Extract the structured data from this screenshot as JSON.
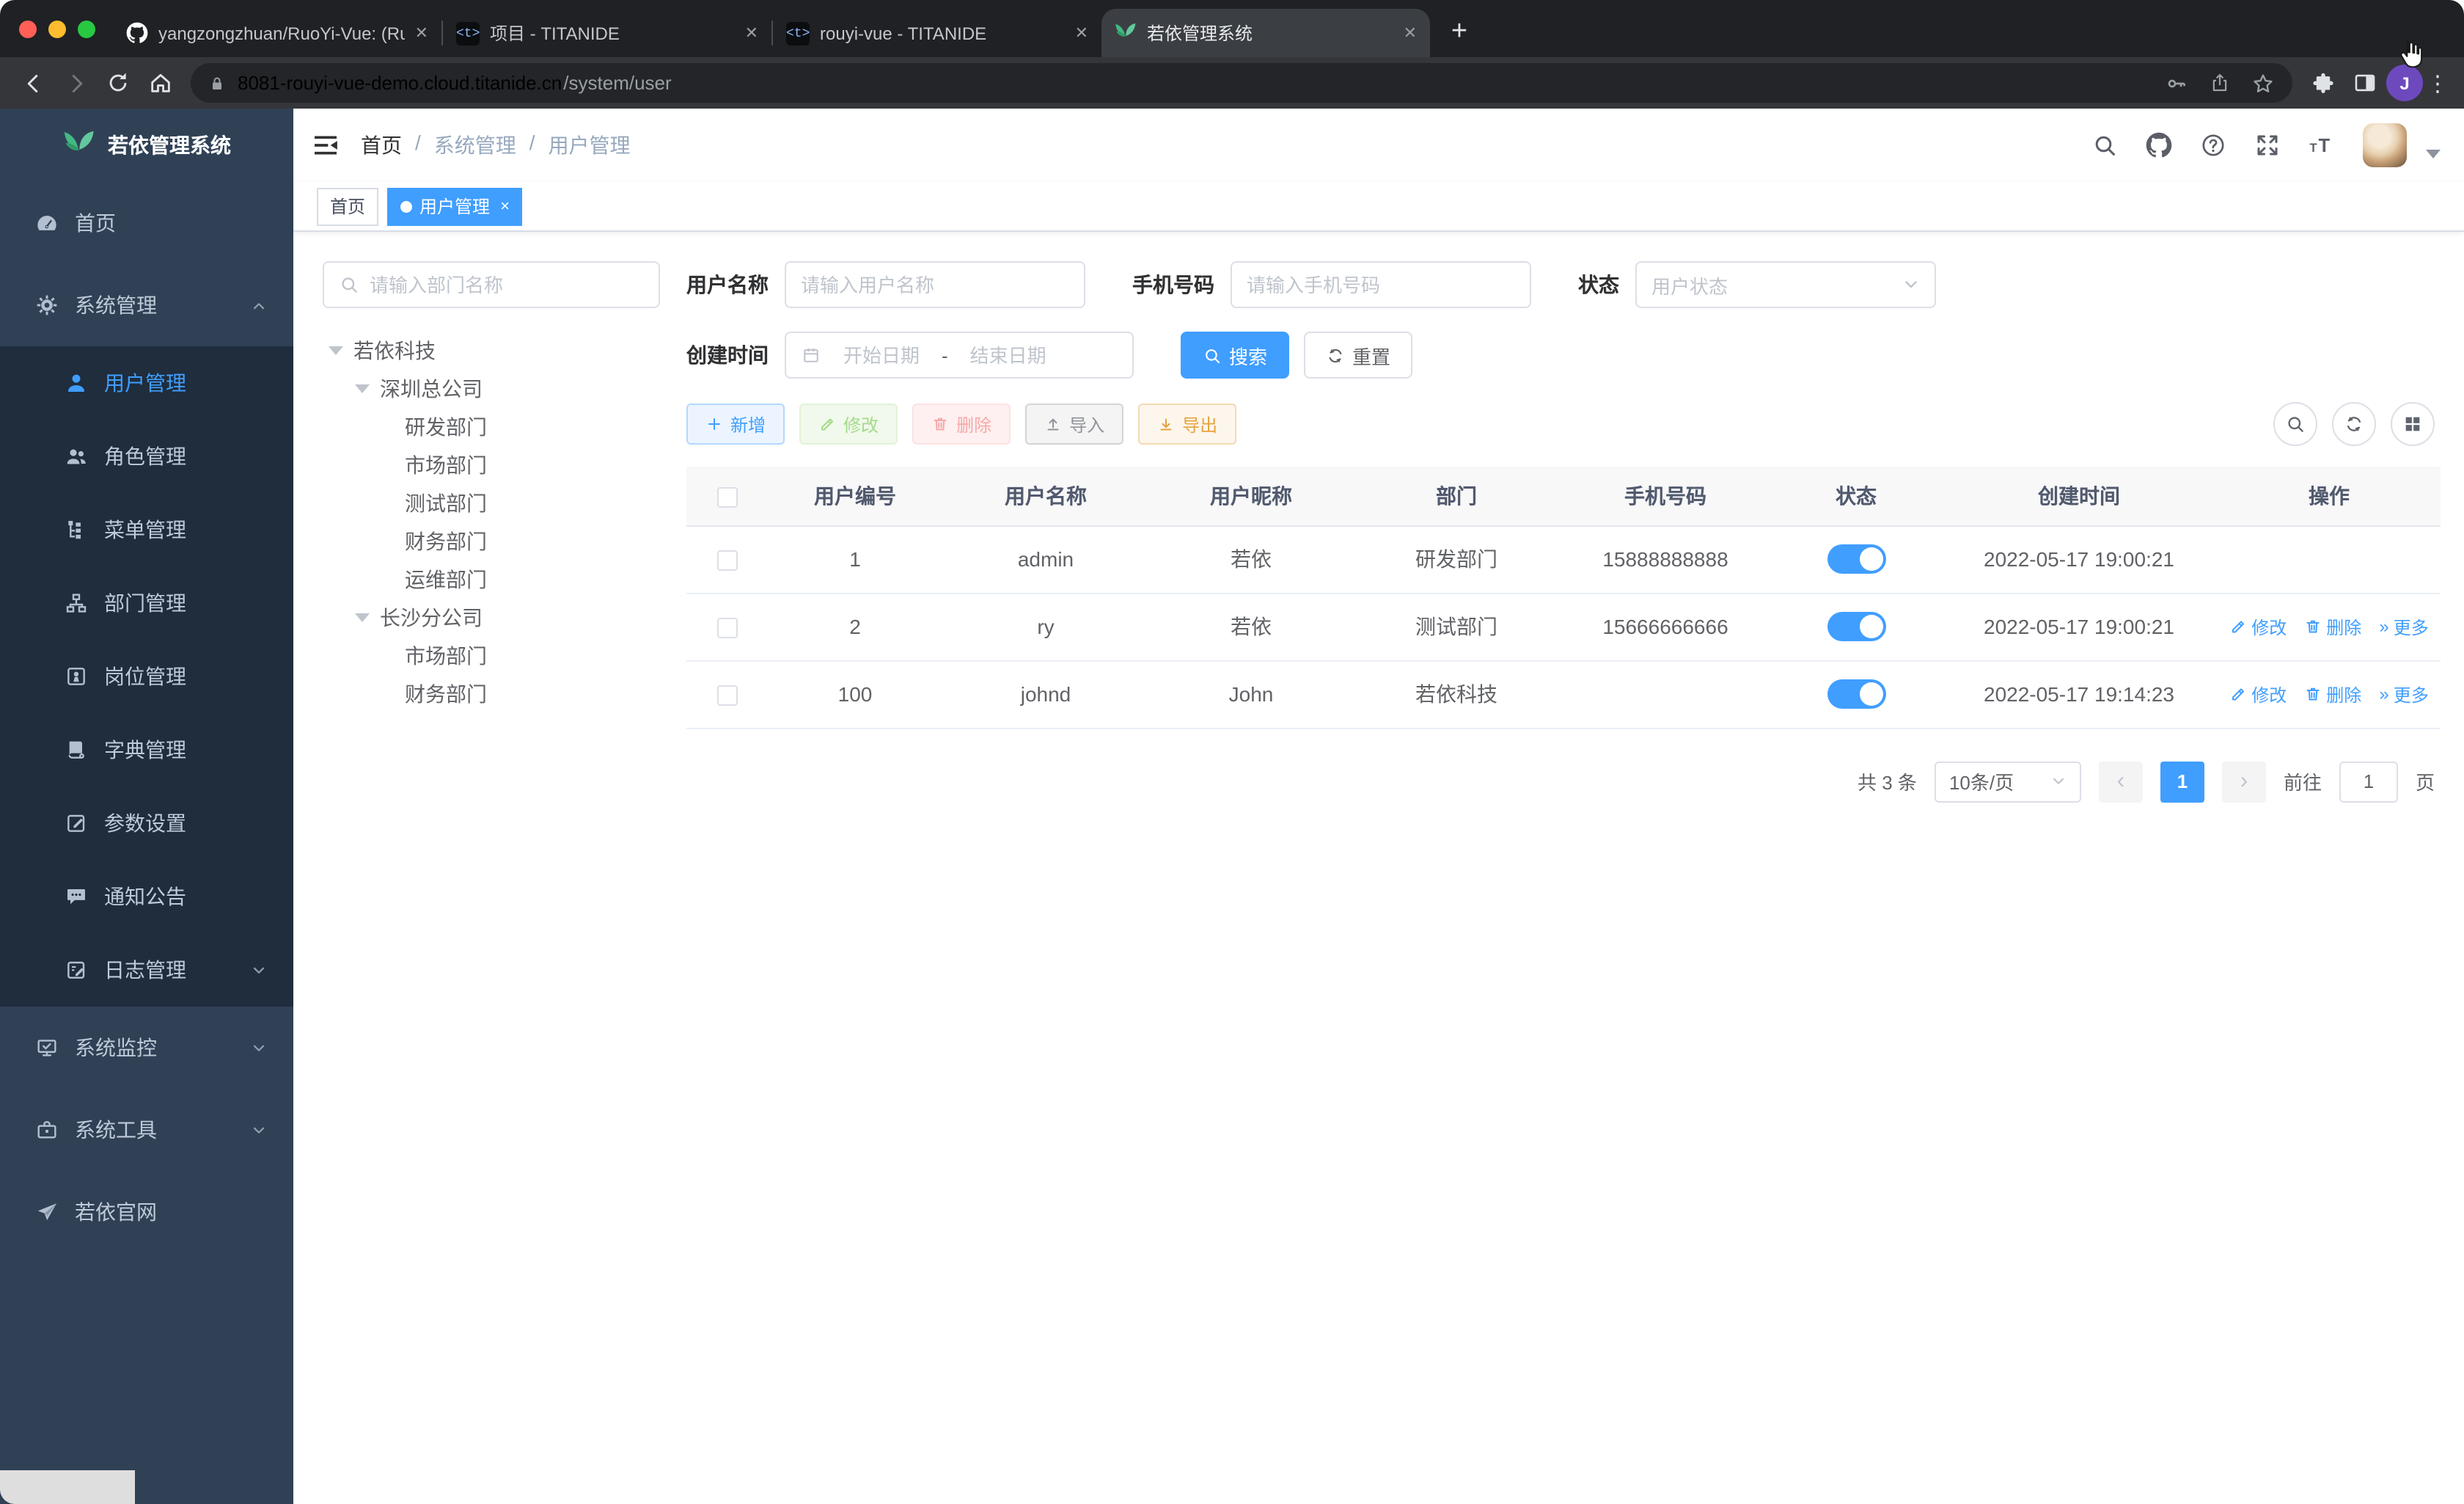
{
  "browser": {
    "tabs": [
      {
        "title": "yangzongzhuan/RuoYi-Vue: (Ru",
        "icon": "github"
      },
      {
        "title": "项目 - TITANIDE",
        "icon": "titanide"
      },
      {
        "title": "rouyi-vue - TITANIDE",
        "icon": "titanide"
      },
      {
        "title": "若依管理系统",
        "icon": "ruoyi-leaf"
      }
    ],
    "code_icon_glyph": "<t>",
    "close_glyph": "✕",
    "new_tab_glyph": "+",
    "url": {
      "host": "8081-rouyi-vue-demo.cloud.titanide.cn",
      "path": "/system/user"
    },
    "profile_initial": "J",
    "menu_glyph": "⋮"
  },
  "sidebar": {
    "logo_title": "若依管理系统",
    "items": [
      {
        "label": "首页",
        "icon": "dashboard"
      },
      {
        "label": "系统管理",
        "icon": "gear",
        "chevron": "up"
      },
      {
        "label": "用户管理",
        "icon": "user",
        "active": true
      },
      {
        "label": "角色管理",
        "icon": "users"
      },
      {
        "label": "菜单管理",
        "icon": "menu-tree"
      },
      {
        "label": "部门管理",
        "icon": "org-tree"
      },
      {
        "label": "岗位管理",
        "icon": "badge"
      },
      {
        "label": "字典管理",
        "icon": "dictionary"
      },
      {
        "label": "参数设置",
        "icon": "edit-square"
      },
      {
        "label": "通知公告",
        "icon": "message"
      },
      {
        "label": "日志管理",
        "icon": "log",
        "chevron": "down"
      },
      {
        "label": "系统监控",
        "icon": "monitor",
        "chevron": "down"
      },
      {
        "label": "系统工具",
        "icon": "toolbox",
        "chevron": "down"
      },
      {
        "label": "若依官网",
        "icon": "paper-plane"
      }
    ]
  },
  "navbar": {
    "breadcrumb": [
      "首页",
      "系统管理",
      "用户管理"
    ],
    "separator": "/",
    "icons": [
      "search",
      "github",
      "help",
      "fullscreen",
      "font-size"
    ]
  },
  "tags": [
    {
      "label": "首页"
    },
    {
      "label": "用户管理",
      "active": true,
      "close_glyph": "×"
    }
  ],
  "dept_panel": {
    "search_placeholder": "请输入部门名称",
    "tree": [
      {
        "label": "若依科技",
        "children": [
          {
            "label": "深圳总公司",
            "children": [
              {
                "label": "研发部门"
              },
              {
                "label": "市场部门"
              },
              {
                "label": "测试部门"
              },
              {
                "label": "财务部门"
              },
              {
                "label": "运维部门"
              }
            ]
          },
          {
            "label": "长沙分公司",
            "children": [
              {
                "label": "市场部门"
              },
              {
                "label": "财务部门"
              }
            ]
          }
        ]
      }
    ]
  },
  "filter": {
    "username_label": "用户名称",
    "username_placeholder": "请输入用户名称",
    "phone_label": "手机号码",
    "phone_placeholder": "请输入手机号码",
    "status_label": "状态",
    "status_placeholder": "用户状态",
    "created_label": "创建时间",
    "date_start_placeholder": "开始日期",
    "date_separator": "-",
    "date_end_placeholder": "结束日期",
    "search_button": "搜索",
    "reset_button": "重置"
  },
  "toolbar": {
    "add": "新增",
    "edit": "修改",
    "delete": "删除",
    "import": "导入",
    "export": "导出"
  },
  "table": {
    "columns": [
      "用户编号",
      "用户名称",
      "用户昵称",
      "部门",
      "手机号码",
      "状态",
      "创建时间",
      "操作"
    ],
    "row_actions": {
      "edit": "修改",
      "delete": "删除",
      "more": "更多",
      "more_glyph": "»"
    },
    "rows": [
      {
        "user_id": "1",
        "username": "admin",
        "nickname": "若依",
        "dept": "研发部门",
        "phone": "15888888888",
        "status": "on",
        "created": "2022-05-17 19:00:21",
        "has_actions": false
      },
      {
        "user_id": "2",
        "username": "ry",
        "nickname": "若依",
        "dept": "测试部门",
        "phone": "15666666666",
        "status": "on",
        "created": "2022-05-17 19:00:21",
        "has_actions": true
      },
      {
        "user_id": "100",
        "username": "johnd",
        "nickname": "John",
        "dept": "若依科技",
        "phone": "",
        "status": "on",
        "created": "2022-05-17 19:14:23",
        "has_actions": true
      }
    ]
  },
  "pagination": {
    "total": "共 3 条",
    "page_size": "10条/页",
    "current_page": "1",
    "prev_glyph": "‹",
    "next_glyph": "›",
    "goto_label": "前往",
    "goto_value": "1",
    "unit_label": "页"
  },
  "colors": {
    "primary": "#409EFF",
    "success": "#67C23A",
    "danger": "#F56C6C",
    "warning": "#E6A23C",
    "info": "#909399",
    "sidebar_bg": "#304156",
    "submenu_bg": "#1F2D3D",
    "chrome_bg": "#202124"
  }
}
